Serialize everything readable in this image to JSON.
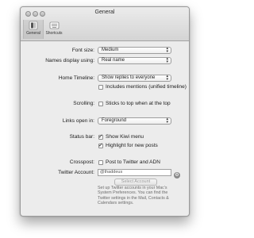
{
  "window": {
    "title": "General"
  },
  "toolbar": {
    "items": [
      {
        "label": "General",
        "icon": "toggle-switch-icon",
        "active": true
      },
      {
        "label": "Shortcuts",
        "icon": "keyboard-icon",
        "active": false
      }
    ]
  },
  "settings": {
    "font_size": {
      "label": "Font size:",
      "value": "Medium"
    },
    "names_display": {
      "label": "Names display using:",
      "value": "Real name"
    },
    "home_timeline": {
      "label": "Home Timeline:",
      "value": "Show replies to everyone",
      "include_mentions": {
        "label": "Includes mentions (unified timeline)",
        "checked": false
      }
    },
    "scrolling": {
      "label": "Scrolling:",
      "option": {
        "label": "Sticks to top when at the top",
        "checked": false
      }
    },
    "links_open_in": {
      "label": "Links open in:",
      "value": "Foreground"
    },
    "status_bar": {
      "label": "Status bar:",
      "show_menu": {
        "label": "Show Kiwi menu",
        "checked": true
      },
      "highlight": {
        "label": "Highlight for new posts",
        "checked": true
      }
    },
    "crosspost": {
      "label": "Crosspost:",
      "option": {
        "label": "Post to Twitter and ADN",
        "checked": false
      }
    },
    "twitter_account": {
      "label": "Twitter Account:",
      "value": "@thaddeus"
    },
    "select_account_button": "Select Account",
    "help_text": "Set up Twitter accounts in your Mac's System Preferences. You can find the Twitter settings in the Mail, Contacts & Calendars settings."
  }
}
